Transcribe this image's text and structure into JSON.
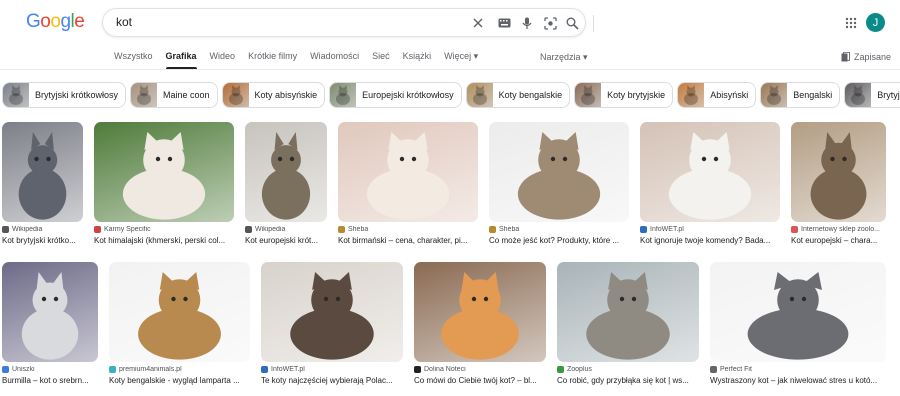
{
  "logo": {
    "letters": [
      "G",
      "o",
      "o",
      "g",
      "l",
      "e"
    ],
    "colors": [
      "#4285F4",
      "#EA4335",
      "#FBBC05",
      "#4285F4",
      "#34A853",
      "#EA4335"
    ]
  },
  "search": {
    "value": "kot",
    "icons": [
      "close-icon",
      "keyboard-icon",
      "microphone-icon",
      "lens-icon",
      "search-icon"
    ]
  },
  "account": {
    "avatar_letter": "J",
    "avatar_color": "#0b8a8a"
  },
  "tabs": [
    {
      "label": "Wszystko",
      "active": false
    },
    {
      "label": "Grafika",
      "active": true
    },
    {
      "label": "Wideo",
      "active": false
    },
    {
      "label": "Krótkie filmy",
      "active": false
    },
    {
      "label": "Wiadomości",
      "active": false
    },
    {
      "label": "Sieć",
      "active": false
    },
    {
      "label": "Książki",
      "active": false
    },
    {
      "label": "Więcej ▾",
      "active": false
    }
  ],
  "tools_label": "Narzędzia ▾",
  "saved_label": "Zapisane",
  "chips": [
    {
      "label": "Brytyjski krótkowłosy",
      "color": "#7a7f86"
    },
    {
      "label": "Maine coon",
      "color": "#a58f7a"
    },
    {
      "label": "Koty abisyńskie",
      "color": "#b36b32"
    },
    {
      "label": "Europejski krótkowłosy",
      "color": "#7c8b6e"
    },
    {
      "label": "Koty bengalskie",
      "color": "#b08d5b"
    },
    {
      "label": "Koty brytyjskie",
      "color": "#8a6a55"
    },
    {
      "label": "Abisyński",
      "color": "#c47a3a"
    },
    {
      "label": "Bengalski",
      "color": "#9a7550"
    },
    {
      "label": "Brytyjs",
      "color": "#5d5a5e"
    }
  ],
  "results": [
    {
      "source": "Wikipedia",
      "title": "Kot brytyjski krótko...",
      "bg": "#7d7f88",
      "cat": "#5f636d",
      "fav": "#555"
    },
    {
      "source": "Karmy Specific",
      "title": "Kot himalajski (khmerski, perski col...",
      "bg": "#4f7b3a",
      "cat": "#efe9e2",
      "fav": "#c44"
    },
    {
      "source": "Wikipedia",
      "title": "Kot europejski krót...",
      "bg": "#c7c3bd",
      "cat": "#7b6f5e",
      "fav": "#555"
    },
    {
      "source": "Sheba",
      "title": "Kot birmański – cena, charakter, pi...",
      "bg": "#e0c8bd",
      "cat": "#f3ebe2",
      "fav": "#b8892e"
    },
    {
      "source": "Sheba",
      "title": "Co może jeść kot? Produkty, które ...",
      "bg": "#ececec",
      "cat": "#9f8b74",
      "fav": "#b8892e"
    },
    {
      "source": "InfoWET.pl",
      "title": "Kot ignoruje twoje komendy? Bada...",
      "bg": "#d4c2b6",
      "cat": "#f4f2ef",
      "fav": "#2e6cbf"
    },
    {
      "source": "Internetowy sklep zoolo...",
      "title": "Kot europejski – chara...",
      "bg": "#b39d84",
      "cat": "#7a6550",
      "fav": "#d55"
    },
    {
      "source": "Uniszki",
      "title": "Burmilla – kot o srebrn...",
      "bg": "#6d6a88",
      "cat": "#d9dadd",
      "fav": "#3b7dd8"
    },
    {
      "source": "premium4animals.pl",
      "title": "Koty bengalskie - wygląd lamparta ...",
      "bg": "#f2f2f2",
      "cat": "#b98a4f",
      "fav": "#3bb0c9"
    },
    {
      "source": "InfoWET.pl",
      "title": "Te koty najczęściej wybierają Polac...",
      "bg": "#d8d2cb",
      "cat": "#5a4a40",
      "fav": "#2e6cbf"
    },
    {
      "source": "Dolina Noteci",
      "title": "Co mówi do Ciebie twój kot? – bl...",
      "bg": "#8a6a52",
      "cat": "#e39a52",
      "fav": "#222"
    },
    {
      "source": "Zooplus",
      "title": "Co robić, gdy przybłąka się kot | ws...",
      "bg": "#a9b4b8",
      "cat": "#8f8a82",
      "fav": "#3a9a3a"
    },
    {
      "source": "Perfect Fit",
      "title": "Wystraszony kot – jak niwelować stres u kotó...",
      "bg": "#f3f3f3",
      "cat": "#6b6d72",
      "fav": "#666"
    }
  ]
}
